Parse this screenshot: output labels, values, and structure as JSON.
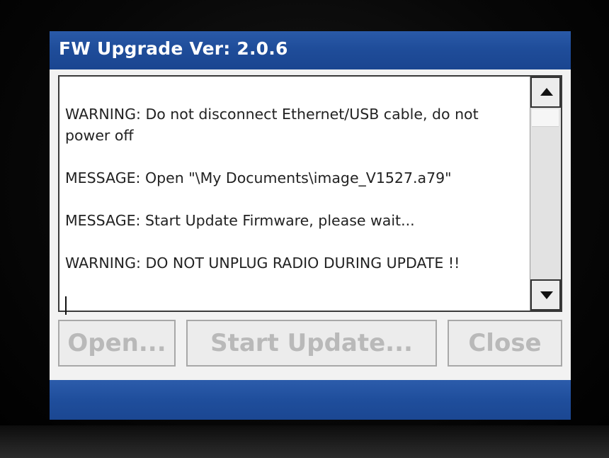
{
  "window": {
    "title": "FW Upgrade Ver: 2.0.6"
  },
  "log": {
    "lines": [
      "WARNING: Do not disconnect Ethernet/USB cable, do not power off",
      "MESSAGE: Open \"\\My Documents\\image_V1527.a79\"",
      "MESSAGE: Start Update Firmware, please wait...",
      "WARNING: DO NOT UNPLUG RADIO DURING UPDATE !!"
    ]
  },
  "buttons": {
    "open_label": "Open...",
    "start_label": "Start Update...",
    "close_label": "Close"
  },
  "colors": {
    "titlebar": "#1f4d9a",
    "taskbar": "#1f4e9c",
    "disabled_text": "#b9b9b9"
  }
}
